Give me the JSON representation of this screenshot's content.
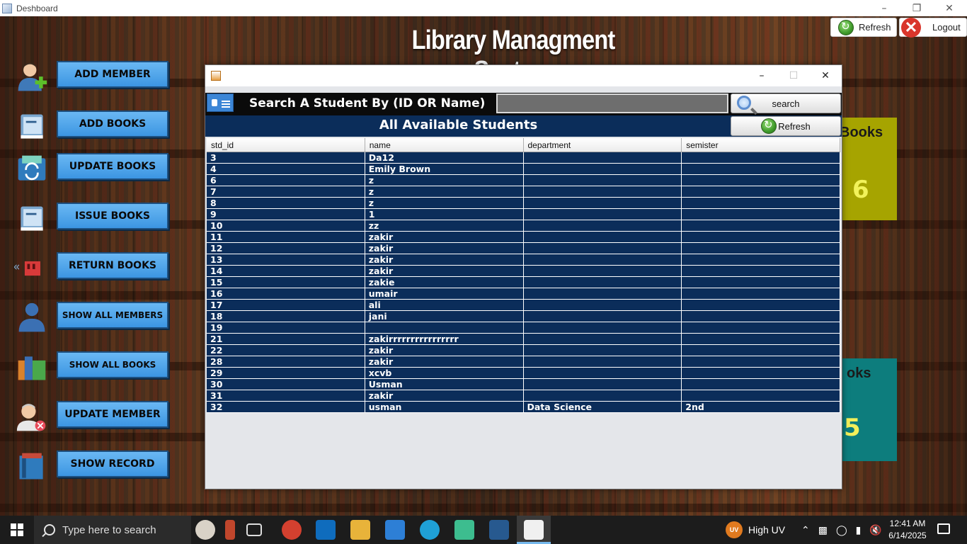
{
  "window": {
    "title": "Deshboard"
  },
  "header": {
    "title": "Library Managment System",
    "refresh_label": "Refresh",
    "logout_label": "Logout"
  },
  "menu": {
    "items": [
      {
        "label": "ADD MEMBER",
        "icon": "add-user-icon"
      },
      {
        "label": "ADD BOOKS",
        "icon": "book-icon"
      },
      {
        "label": "UPDATE BOOKS",
        "icon": "update-icon"
      },
      {
        "label": "ISSUE BOOKS",
        "icon": "book-icon"
      },
      {
        "label": "RETURN BOOKS",
        "icon": "return-icon"
      },
      {
        "label": "SHOW ALL MEMBERS",
        "icon": "user-icon"
      },
      {
        "label": "SHOW ALL BOOKS",
        "icon": "books-icon"
      },
      {
        "label": "UPDATE MEMBER",
        "icon": "remove-user-icon"
      },
      {
        "label": "SHOW RECORD",
        "icon": "record-icon"
      }
    ]
  },
  "cards": [
    {
      "label": "Books",
      "value": "6",
      "color": "#a6a400",
      "value_color": "#f2f25a"
    },
    {
      "label": "oks",
      "value": "5",
      "color": "#0d7d7d",
      "value_color": "#f3ef5a"
    }
  ],
  "dialog": {
    "search_label": "Search A Student By (ID OR Name)",
    "search_value": "",
    "search_button": "search",
    "refresh_button": "Refresh",
    "table_title": "All Available Students",
    "columns": [
      "std_id",
      "name",
      "department",
      "semister"
    ],
    "rows": [
      [
        "3",
        "Da12",
        "",
        ""
      ],
      [
        "4",
        "Emily Brown",
        "",
        ""
      ],
      [
        "6",
        "z",
        "",
        ""
      ],
      [
        "7",
        "z",
        "",
        ""
      ],
      [
        "8",
        "z",
        "",
        ""
      ],
      [
        "9",
        "1",
        "",
        ""
      ],
      [
        "10",
        "zz",
        "",
        ""
      ],
      [
        "11",
        "zakir",
        "",
        ""
      ],
      [
        "12",
        "zakir",
        "",
        ""
      ],
      [
        "13",
        "zakir",
        "",
        ""
      ],
      [
        "14",
        "zakir",
        "",
        ""
      ],
      [
        "15",
        "zakie",
        "",
        ""
      ],
      [
        "16",
        "umair",
        "",
        ""
      ],
      [
        "17",
        "ali",
        "",
        ""
      ],
      [
        "18",
        "jani",
        "",
        ""
      ],
      [
        "19",
        "",
        "",
        ""
      ],
      [
        "21",
        "zakirrrrrrrrrrrrrrrr",
        "",
        ""
      ],
      [
        "22",
        "zakir",
        "",
        ""
      ],
      [
        "28",
        "zakir",
        "",
        ""
      ],
      [
        "29",
        "xcvb",
        "",
        ""
      ],
      [
        "30",
        "Usman",
        "",
        ""
      ],
      [
        "31",
        "zakir",
        "",
        ""
      ],
      [
        "32",
        "usman",
        "Data Science",
        "2nd"
      ]
    ]
  },
  "taskbar": {
    "search_placeholder": "Type here to search",
    "weather": "High UV",
    "uv_badge": "UV",
    "time": "12:41 AM",
    "date": "6/14/2025"
  },
  "colors": {
    "menu_button": "#3c95e2",
    "dialog_band": "#0b2d5a",
    "table_header": "#ececec"
  }
}
